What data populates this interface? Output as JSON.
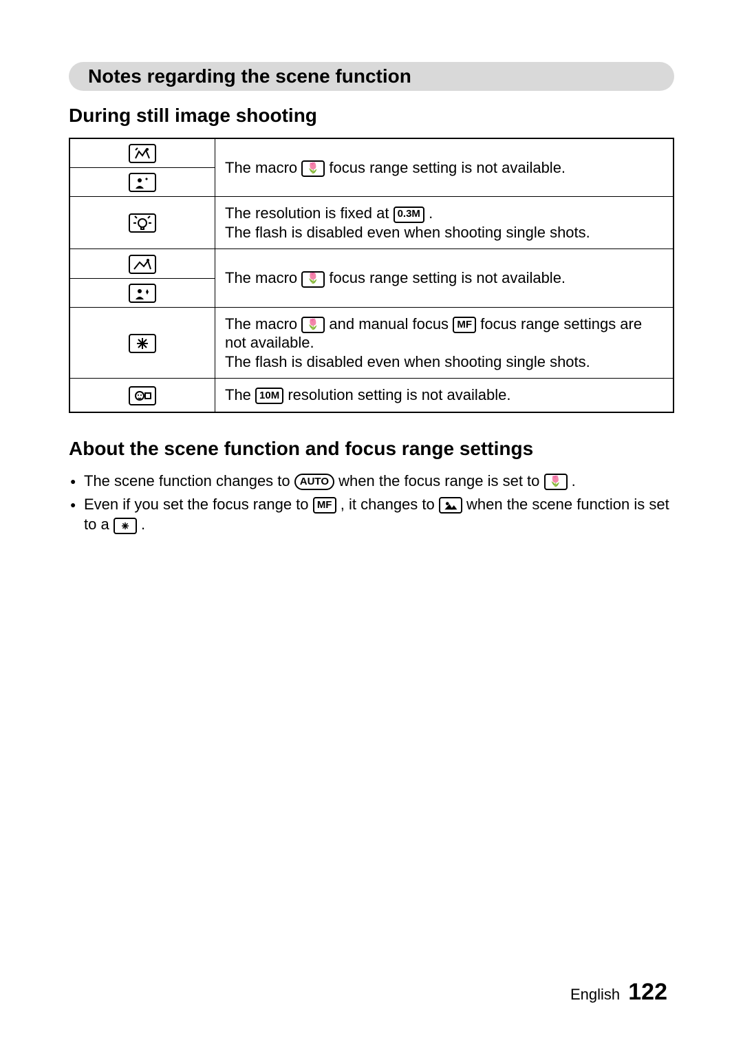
{
  "section_title": "Notes regarding the scene function",
  "subheading_1": "During still image shooting",
  "subheading_2": "About the scene function and focus range settings",
  "icons": {
    "sports": "sports-icon",
    "night_portrait": "night-portrait-icon",
    "lamp": "lamp-icon",
    "landscape": "landscape-icon",
    "portrait_star": "portrait-star-icon",
    "fireworks": "fireworks-icon",
    "face": "face-icon",
    "macro_tulip": "🌷",
    "mf": "MF",
    "auto": "AUTO",
    "scene_mountain": "scene-mountain-icon",
    "res_03m": "0.3M",
    "res_10m": "10M"
  },
  "rows": {
    "r1_pre": "The macro ",
    "r1_post": " focus range setting is not available.",
    "r2_l1_pre": "The resolution is fixed at ",
    "r2_l1_post": ".",
    "r2_l2": "The flash is disabled even when shooting single shots.",
    "r3_pre": "The macro ",
    "r3_post": " focus range setting is not available.",
    "r4_l1_pre": "The macro ",
    "r4_l1_mid": " and manual focus ",
    "r4_l1_post": " focus range settings are not available.",
    "r4_l2": "The flash is disabled even when shooting single shots.",
    "r5_pre": "The ",
    "r5_post": " resolution setting is not available."
  },
  "bullets": {
    "b1_pre": "The scene function changes to ",
    "b1_mid": " when the focus range is set to ",
    "b1_post": ".",
    "b2_pre": "Even if you set the focus range to ",
    "b2_mid1": ", it changes to ",
    "b2_mid2": " when the scene function is set to a ",
    "b2_post": "."
  },
  "footer": {
    "lang": "English",
    "page": "122"
  }
}
